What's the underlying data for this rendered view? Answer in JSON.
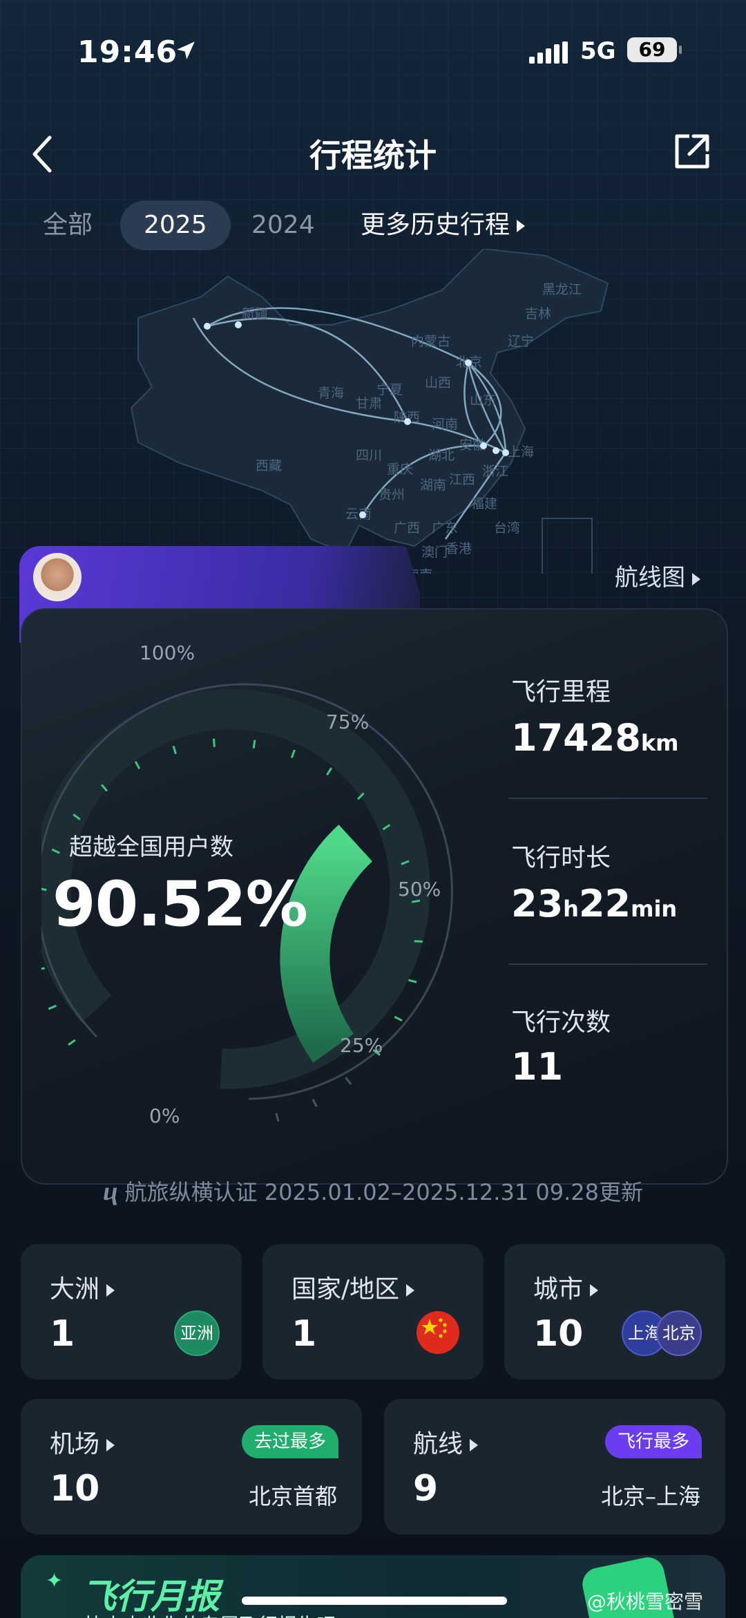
{
  "status_bar": {
    "time": "19:46",
    "network": "5G",
    "battery": "69"
  },
  "header": {
    "title": "行程统计"
  },
  "tabs": [
    {
      "label": "全部",
      "active": false
    },
    {
      "label": "2025",
      "active": true
    },
    {
      "label": "2024",
      "active": false
    },
    {
      "label": "更多历史行程",
      "active": false
    }
  ],
  "map": {
    "provinces": [
      "新疆",
      "黑龙江",
      "吉林",
      "内蒙古",
      "辽宁",
      "北京",
      "宁夏",
      "山西",
      "青海",
      "甘肃",
      "山东",
      "陕西",
      "河南",
      "西藏",
      "四川",
      "湖北",
      "安徽",
      "上海",
      "重庆",
      "浙江",
      "贵州",
      "湖南",
      "江西",
      "福建",
      "云南",
      "广西",
      "广东",
      "台湾",
      "香港",
      "澳门",
      "海南"
    ],
    "route_color": "#8fb7cf",
    "link_label": "航线图"
  },
  "gauge": {
    "title": "超越全国用户数",
    "value_text": "90.52%",
    "value": 90.52,
    "ticks": [
      "100%",
      "75%",
      "50%",
      "25%",
      "0%"
    ],
    "color": "#3ec97a"
  },
  "stats": [
    {
      "label": "飞行里程",
      "value": "17428",
      "unit": "km"
    },
    {
      "label": "飞行时长",
      "value_h": "23",
      "unit_h": "h",
      "value_m": "22",
      "unit_m": "min"
    },
    {
      "label": "飞行次数",
      "value": "11"
    }
  ],
  "certification": "航旅纵横认证 2025.01.02–2025.12.31 09.28更新",
  "tiles_row1": [
    {
      "label": "大洲",
      "value": "1",
      "badge": "亚洲"
    },
    {
      "label": "国家/地区",
      "value": "1"
    },
    {
      "label": "城市",
      "value": "10",
      "badges": [
        "上海",
        "北京"
      ]
    }
  ],
  "tiles_row2": [
    {
      "label": "机场",
      "value": "10",
      "tag": "去过最多",
      "detail": "北京首都"
    },
    {
      "label": "航线",
      "value": "9",
      "tag": "飞行最多",
      "detail": "北京–上海"
    }
  ],
  "banner": {
    "title": "飞行月报",
    "subtitle": "快来查收你的专属飞行报告吧"
  },
  "watermark": "@秋桃雪密雪"
}
